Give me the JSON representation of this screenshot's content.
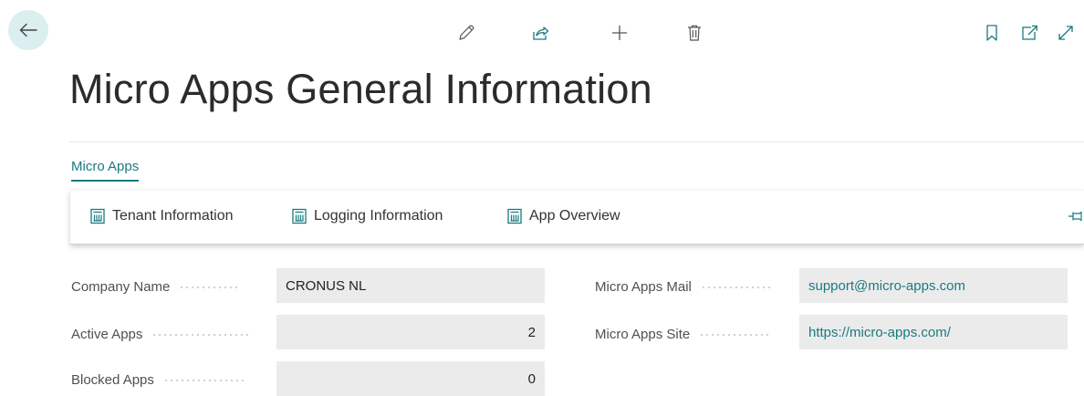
{
  "page": {
    "title": "Micro Apps General Information",
    "back_icon": "arrow-left-icon",
    "accent_color": "#1b7a80",
    "toolbar": [
      {
        "name": "edit-icon"
      },
      {
        "name": "share-icon"
      },
      {
        "name": "add-icon"
      },
      {
        "name": "delete-icon"
      },
      {
        "name": "bookmark-icon"
      },
      {
        "name": "open-new-window-icon"
      },
      {
        "name": "expand-icon"
      }
    ]
  },
  "tabs": [
    {
      "label": "Micro Apps"
    }
  ],
  "actions": [
    {
      "label": "Tenant Information",
      "icon": "report-icon"
    },
    {
      "label": "Logging Information",
      "icon": "report-icon"
    },
    {
      "label": "App Overview",
      "icon": "report-icon"
    }
  ],
  "pin_icon": "pin-icon",
  "fields_left": [
    {
      "label": "Company Name",
      "value": "CRONUS NL"
    },
    {
      "label": "Active Apps",
      "value": "2"
    },
    {
      "label": "Blocked Apps",
      "value": "0"
    }
  ],
  "fields_right": [
    {
      "label": "Micro Apps Mail",
      "value": "support@micro-apps.com"
    },
    {
      "label": "Micro Apps Site",
      "value": "https://micro-apps.com/"
    }
  ]
}
